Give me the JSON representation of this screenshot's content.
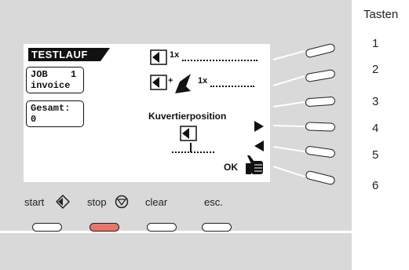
{
  "legend": {
    "title": "Tasten",
    "numbers": [
      "1",
      "2",
      "3",
      "4",
      "5",
      "6"
    ]
  },
  "display": {
    "mode_title": "TESTLAUF",
    "job_label": "JOB",
    "job_number": "1",
    "job_name": "invoice",
    "total_label": "Gesamt:",
    "total_value": "0",
    "row1_count": "1x",
    "row2_count": "1x",
    "position_label": "Kuvertierposition",
    "ok_label": "OK"
  },
  "buttons": {
    "start": "start",
    "stop": "stop",
    "clear": "clear",
    "esc": "esc."
  },
  "colors": {
    "panel": "#d9d9d9",
    "stop_button": "#e8776a",
    "lcd": "#ffffff"
  }
}
